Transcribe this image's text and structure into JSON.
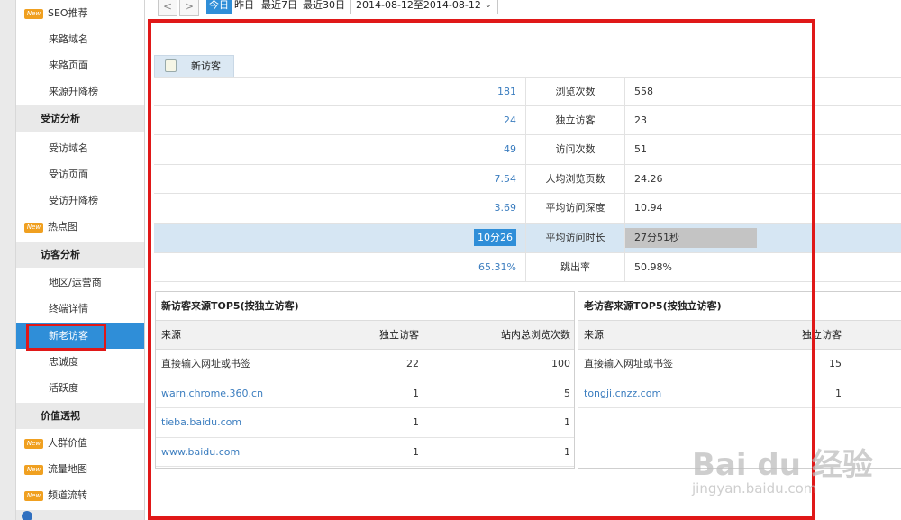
{
  "sidebar": {
    "items": [
      {
        "label": "SEO推荐",
        "kind": "new",
        "badge": "New"
      },
      {
        "label": "来路域名",
        "kind": "sub"
      },
      {
        "label": "来路页面",
        "kind": "sub"
      },
      {
        "label": "来源升降榜",
        "kind": "sub"
      },
      {
        "label": "受访分析",
        "kind": "header"
      },
      {
        "label": "受访域名",
        "kind": "sub"
      },
      {
        "label": "受访页面",
        "kind": "sub"
      },
      {
        "label": "受访升降榜",
        "kind": "sub"
      },
      {
        "label": "热点图",
        "kind": "new",
        "badge": "New"
      },
      {
        "label": "访客分析",
        "kind": "header"
      },
      {
        "label": "地区/运营商",
        "kind": "sub"
      },
      {
        "label": "终端详情",
        "kind": "sub"
      },
      {
        "label": "新老访客",
        "kind": "sub",
        "active": true
      },
      {
        "label": "忠诚度",
        "kind": "sub"
      },
      {
        "label": "活跃度",
        "kind": "sub"
      },
      {
        "label": "价值透视",
        "kind": "header"
      },
      {
        "label": "人群价值",
        "kind": "new",
        "badge": "New"
      },
      {
        "label": "流量地图",
        "kind": "new",
        "badge": "New"
      },
      {
        "label": "频道流转",
        "kind": "new",
        "badge": "New"
      }
    ]
  },
  "toolbar": {
    "prev_icon": "<",
    "next_icon": ">",
    "ranges": [
      "今日",
      "昨日",
      "最近7日",
      "最近30日"
    ],
    "active_range": "今日",
    "date_value": "2014-08-12至2014-08-12"
  },
  "tab": {
    "label": "新访客"
  },
  "stats": [
    {
      "new": "181",
      "label": "浏览次数",
      "old": "558"
    },
    {
      "new": "24",
      "label": "独立访客",
      "old": "23"
    },
    {
      "new": "49",
      "label": "访问次数",
      "old": "51"
    },
    {
      "new": "7.54",
      "label": "人均浏览页数",
      "old": "24.26"
    },
    {
      "new": "3.69",
      "label": "平均访问深度",
      "old": "10.94"
    },
    {
      "new": "10分26",
      "label": "平均访问时长",
      "old": "27分51秒",
      "highlight": true
    },
    {
      "new": "65.31%",
      "label": "跳出率",
      "old": "50.98%"
    }
  ],
  "new_top5": {
    "title": "新访客来源TOP5(按独立访客)",
    "headers": [
      "来源",
      "独立访客",
      "站内总浏览次数"
    ],
    "rows": [
      {
        "src": "直接输入网址或书签",
        "uv": "22",
        "pv": "100",
        "link": false
      },
      {
        "src": "warn.chrome.360.cn",
        "uv": "1",
        "pv": "5",
        "link": true
      },
      {
        "src": "tieba.baidu.com",
        "uv": "1",
        "pv": "1",
        "link": true
      },
      {
        "src": "www.baidu.com",
        "uv": "1",
        "pv": "1",
        "link": true
      }
    ]
  },
  "old_top5": {
    "title": "老访客来源TOP5(按独立访客)",
    "headers": [
      "来源",
      "独立访客"
    ],
    "rows": [
      {
        "src": "直接输入网址或书签",
        "uv": "15",
        "link": false
      },
      {
        "src": "tongji.cnzz.com",
        "uv": "1",
        "link": true
      }
    ]
  },
  "watermark": {
    "line1": "Bai du 经验",
    "line2": "jingyan.baidu.com"
  },
  "colors": {
    "accent": "#2f8ed8",
    "link": "#3b7dbf",
    "annotation": "#e01818",
    "badge": "#f0a020"
  }
}
